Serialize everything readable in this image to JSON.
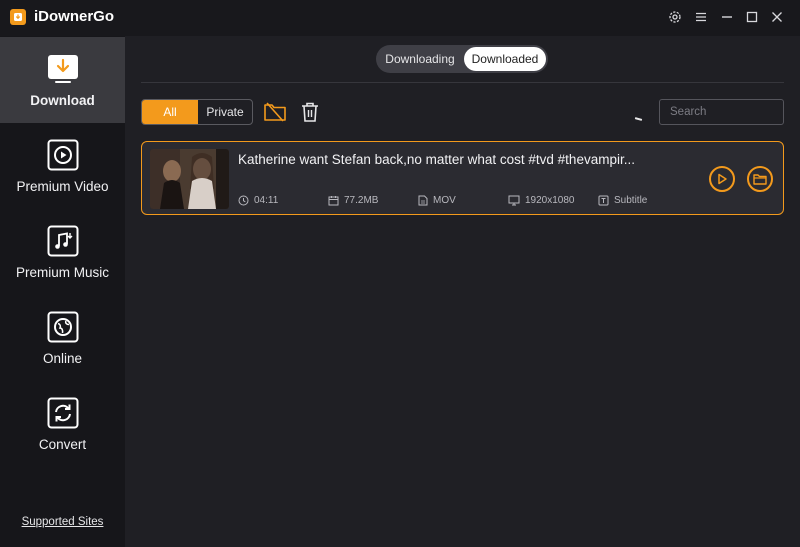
{
  "app": {
    "title": "iDownerGo"
  },
  "titlebar": {
    "icons": [
      "gear-icon",
      "menu-icon",
      "minimize-icon",
      "maximize-icon",
      "close-icon"
    ]
  },
  "sidebar": {
    "items": [
      {
        "label": "Download",
        "icon": "download-icon",
        "active": true
      },
      {
        "label": "Premium Video",
        "icon": "play-icon",
        "active": false
      },
      {
        "label": "Premium Music",
        "icon": "music-icon",
        "active": false
      },
      {
        "label": "Online",
        "icon": "globe-icon",
        "active": false
      },
      {
        "label": "Convert",
        "icon": "refresh-icon",
        "active": false
      }
    ],
    "supported_link": "Supported Sites"
  },
  "tabs": {
    "downloading": "Downloading",
    "downloaded": "Downloaded",
    "selected": "Downloaded"
  },
  "filters": {
    "all": "All",
    "private": "Private",
    "selected": "All"
  },
  "search": {
    "placeholder": "Search"
  },
  "colors": {
    "accent": "#f39a1c",
    "background": "#1f1f24",
    "sidebar": "#16161a",
    "card": "#2b2b31"
  },
  "downloads": [
    {
      "title": "Katherine want Stefan back,no matter what cost #tvd #thevampir...",
      "duration": "04:11",
      "size": "77.2MB",
      "format": "MOV",
      "resolution": "1920x1080",
      "subtitle": "Subtitle"
    }
  ]
}
